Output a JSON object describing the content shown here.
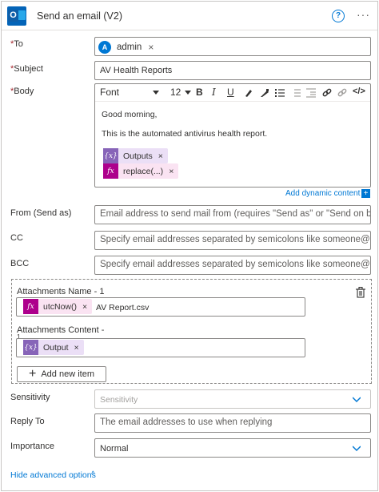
{
  "header": {
    "title": "Send an email (V2)",
    "help": "?",
    "more": "···"
  },
  "to": {
    "label": "To",
    "avatar_initial": "A",
    "value": "admin",
    "remove": "×"
  },
  "subject": {
    "label": "Subject",
    "value": "AV Health Reports"
  },
  "body": {
    "label": "Body",
    "font": "Font",
    "size": "12",
    "lines": [
      "Good morning,",
      "This is the automated antivirus health report."
    ],
    "tokens": [
      {
        "icon": "{x}",
        "label": "Outputs",
        "remove": "×"
      },
      {
        "icon": "fx",
        "label": "replace(...)",
        "remove": "×"
      }
    ]
  },
  "dynamic_content": {
    "label": "Add dynamic content",
    "plus": "+"
  },
  "from": {
    "label": "From (Send as)",
    "placeholder": "Email address to send mail from (requires \"Send as\" or \"Send on b"
  },
  "cc": {
    "label": "CC",
    "placeholder": "Specify email addresses separated by semicolons like someone@c"
  },
  "bcc": {
    "label": "BCC",
    "placeholder": "Specify email addresses separated by semicolons like someone@c"
  },
  "attachments": {
    "name_label": "Attachments Name - 1",
    "name_token": {
      "icon": "fx",
      "label": "utcNow()",
      "remove": "×"
    },
    "name_suffix": "AV Report.csv",
    "content_label": "Attachments Content -",
    "content_label_cont": "1",
    "content_token": {
      "icon": "{x}",
      "label": "Output",
      "remove": "×"
    },
    "add_item": "Add new item",
    "add_plus": "+"
  },
  "sensitivity": {
    "label": "Sensitivity",
    "placeholder": "Sensitivity"
  },
  "reply_to": {
    "label": "Reply To",
    "placeholder": "The email addresses to use when replying"
  },
  "importance": {
    "label": "Importance",
    "value": "Normal"
  },
  "footer": {
    "hide_advanced": "Hide advanced options",
    "caret": "^"
  },
  "required_mark": "*"
}
